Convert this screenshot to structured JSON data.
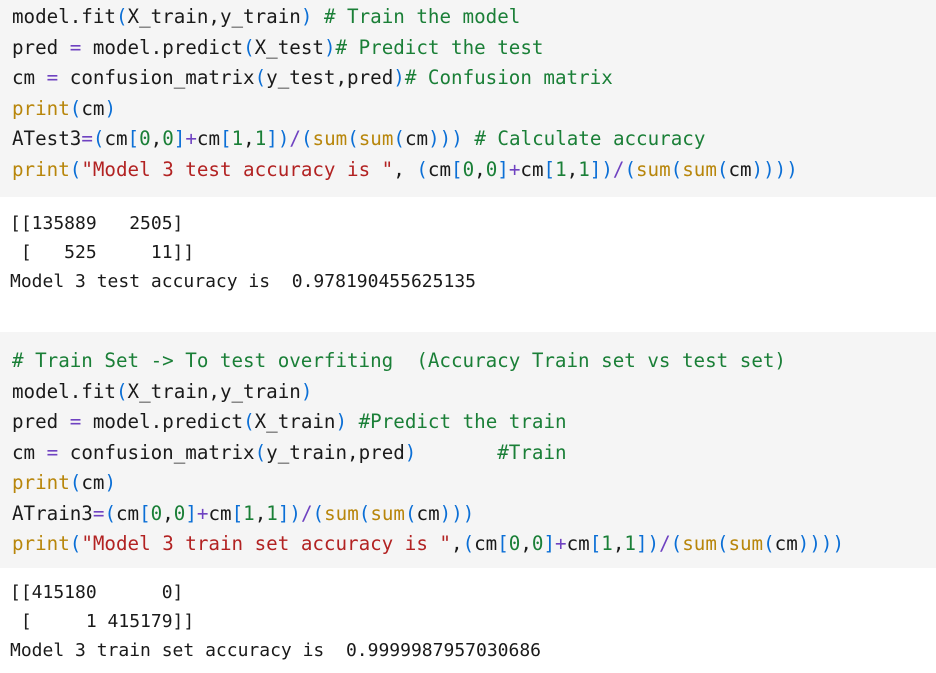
{
  "cell1": {
    "code": [
      "model.fit(X_train,y_train) # Train the model",
      "pred = model.predict(X_test)# Predict the test",
      "cm = confusion_matrix(y_test,pred)# Confusion matrix",
      "print(cm)",
      "ATest3=(cm[0,0]+cm[1,1])/(sum(sum(cm))) # Calculate accuracy",
      "print(\"Model 3 test accuracy is \", (cm[0,0]+cm[1,1])/(sum(sum(cm))))"
    ],
    "output": [
      "[[135889   2505]",
      " [   525     11]]",
      "Model 3 test accuracy is  0.978190455625135"
    ]
  },
  "cell2": {
    "code": [
      "# Train Set -> To test overfiting  (Accuracy Train set vs test set)",
      "model.fit(X_train,y_train)",
      "pred = model.predict(X_train) #Predict the train",
      "cm = confusion_matrix(y_train,pred)       #Train",
      "print(cm)",
      "ATrain3=(cm[0,0]+cm[1,1])/(sum(sum(cm)))",
      "print(\"Model 3 train set accuracy is \",(cm[0,0]+cm[1,1])/(sum(sum(cm))))"
    ],
    "output": [
      "[[415180      0]",
      " [     1 415179]]",
      "Model 3 train set accuracy is  0.9999987957030686"
    ]
  }
}
